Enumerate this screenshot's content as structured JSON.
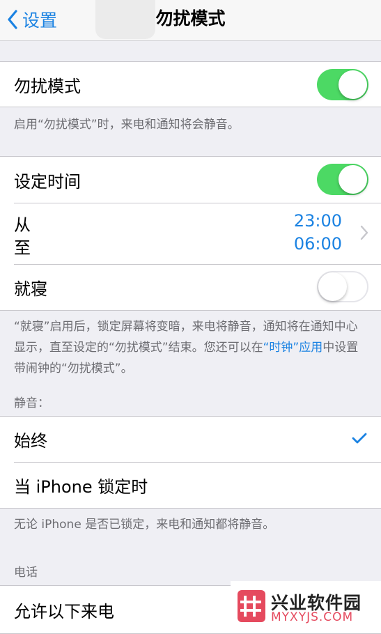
{
  "nav": {
    "back_label": "设置",
    "title": "勿扰模式"
  },
  "dnd": {
    "label": "勿扰模式",
    "enabled": true,
    "footer": "启用“勿扰模式”时，来电和通知将会静音。"
  },
  "schedule": {
    "label": "设定时间",
    "enabled": true,
    "from_label": "从",
    "to_label": "至",
    "from_time": "23:00",
    "to_time": "06:00",
    "bedtime_label": "就寝",
    "bedtime_enabled": false,
    "footer_part1": "“就寝”启用后，锁定屏幕将变暗，来电将静音，通知将在通知中心显示，直至设定的“勿扰模式”结束。您还可以在",
    "footer_link": "“时钟”应用",
    "footer_part2": "中设置带闹钟的“勿扰模式”。"
  },
  "silence": {
    "header": "静音：",
    "options": [
      "始终",
      "当 iPhone 锁定时"
    ],
    "selected": "始终",
    "footer": "无论 iPhone 是否已锁定，来电和通知都将静音。"
  },
  "phone": {
    "header": "电话",
    "allow_calls_label": "允许以下来电"
  },
  "watermark": {
    "name": "兴业软件园",
    "url": "MYXYJS.COM"
  },
  "colors": {
    "accent": "#1a82e2",
    "toggle_on": "#4cd964",
    "background": "#efeff4"
  }
}
